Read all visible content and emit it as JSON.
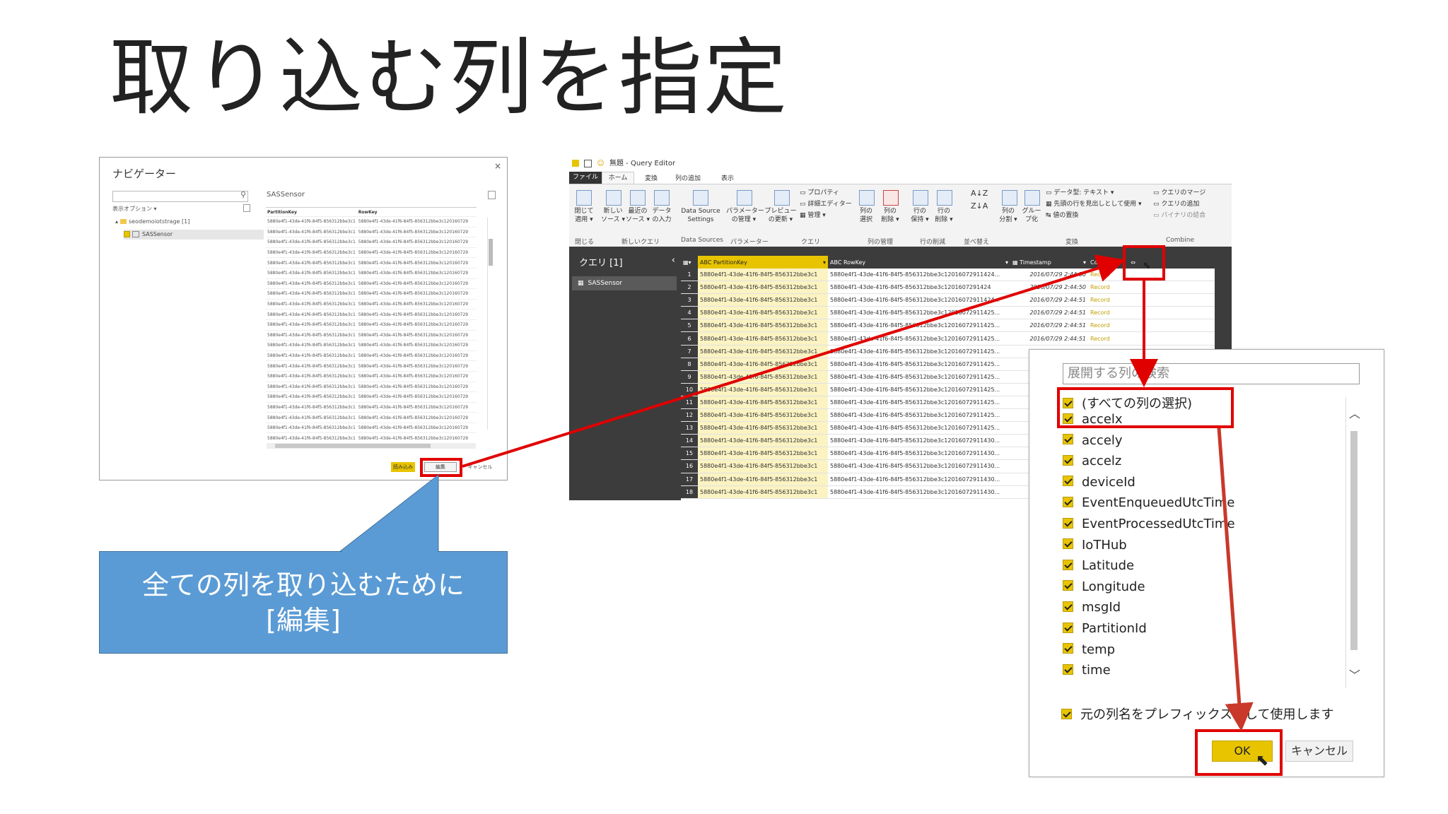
{
  "slide": {
    "title": "取り込む列を指定"
  },
  "navigator": {
    "title": "ナビゲーター",
    "close": "×",
    "options_label": "表示オプション ▾",
    "tree_storage": "seodemoiotstrage [1]",
    "tree_table": "SASSensor",
    "preview_title": "SASSensor",
    "columns": [
      "PartitionKey",
      "RowKey"
    ],
    "rows": [
      [
        "5880e4f1-43de-41f6-84f5-856312bbe3c1",
        "5880e4f1-43de-41f6-84f5-856312bbe3c120160729"
      ],
      [
        "5880e4f1-43de-41f6-84f5-856312bbe3c1",
        "5880e4f1-43de-41f6-84f5-856312bbe3c120160729"
      ],
      [
        "5880e4f1-43de-41f6-84f5-856312bbe3c1",
        "5880e4f1-43de-41f6-84f5-856312bbe3c120160729"
      ],
      [
        "5880e4f1-43de-41f6-84f5-856312bbe3c1",
        "5880e4f1-43de-41f6-84f5-856312bbe3c120160729"
      ],
      [
        "5880e4f1-43de-41f6-84f5-856312bbe3c1",
        "5880e4f1-43de-41f6-84f5-856312bbe3c120160729"
      ],
      [
        "5880e4f1-43de-41f6-84f5-856312bbe3c1",
        "5880e4f1-43de-41f6-84f5-856312bbe3c120160729"
      ],
      [
        "5880e4f1-43de-41f6-84f5-856312bbe3c1",
        "5880e4f1-43de-41f6-84f5-856312bbe3c120160729"
      ],
      [
        "5880e4f1-43de-41f6-84f5-856312bbe3c1",
        "5880e4f1-43de-41f6-84f5-856312bbe3c120160729"
      ],
      [
        "5880e4f1-43de-41f6-84f5-856312bbe3c1",
        "5880e4f1-43de-41f6-84f5-856312bbe3c120160729"
      ],
      [
        "5880e4f1-43de-41f6-84f5-856312bbe3c1",
        "5880e4f1-43de-41f6-84f5-856312bbe3c120160729"
      ],
      [
        "5880e4f1-43de-41f6-84f5-856312bbe3c1",
        "5880e4f1-43de-41f6-84f5-856312bbe3c120160729"
      ],
      [
        "5880e4f1-43de-41f6-84f5-856312bbe3c1",
        "5880e4f1-43de-41f6-84f5-856312bbe3c120160729"
      ],
      [
        "5880e4f1-43de-41f6-84f5-856312bbe3c1",
        "5880e4f1-43de-41f6-84f5-856312bbe3c120160729"
      ],
      [
        "5880e4f1-43de-41f6-84f5-856312bbe3c1",
        "5880e4f1-43de-41f6-84f5-856312bbe3c120160729"
      ],
      [
        "5880e4f1-43de-41f6-84f5-856312bbe3c1",
        "5880e4f1-43de-41f6-84f5-856312bbe3c120160729"
      ],
      [
        "5880e4f1-43de-41f6-84f5-856312bbe3c1",
        "5880e4f1-43de-41f6-84f5-856312bbe3c120160729"
      ],
      [
        "5880e4f1-43de-41f6-84f5-856312bbe3c1",
        "5880e4f1-43de-41f6-84f5-856312bbe3c120160729"
      ],
      [
        "5880e4f1-43de-41f6-84f5-856312bbe3c1",
        "5880e4f1-43de-41f6-84f5-856312bbe3c120160729"
      ],
      [
        "5880e4f1-43de-41f6-84f5-856312bbe3c1",
        "5880e4f1-43de-41f6-84f5-856312bbe3c120160729"
      ],
      [
        "5880e4f1-43de-41f6-84f5-856312bbe3c1",
        "5880e4f1-43de-41f6-84f5-856312bbe3c120160729"
      ],
      [
        "5880e4f1-43de-41f6-84f5-856312bbe3c1",
        "5880e4f1-43de-41f6-84f5-856312bbe3c120160729"
      ],
      [
        "5880e4f1-43de-41f6-84f5-856312bbe3c1",
        "5880e4f1-43de-41f6-84f5-856312bbe3c120160729"
      ],
      [
        "5880e4f1-43de-41f6-84f5-856312bbe3c1",
        "5880e4f1-43de-41f6-84f5-856312bbe3c120160729"
      ],
      [
        "5880e4f1-43de-41f6-84f5-856312bbe3c1",
        "5880e4f1-43de-41f6-84f5-856312bbe3c120160729"
      ]
    ],
    "buttons": {
      "load": "読み込み",
      "edit": "編集",
      "cancel": "キャンセル"
    }
  },
  "callout": {
    "line1": "全ての列を取り込むために",
    "line2": "[編集]"
  },
  "query_editor": {
    "title": "無題 - Query Editor",
    "tabs": [
      "ファイル",
      "ホーム",
      "変換",
      "列の追加",
      "表示"
    ],
    "ribbon": {
      "close_apply": [
        "閉じて",
        "適用 ▾"
      ],
      "new_source": [
        "新しい",
        "ソース ▾"
      ],
      "recent_source": [
        "最近の",
        "ソース ▾"
      ],
      "enter_data": [
        "データ",
        "の入力"
      ],
      "ds_settings": [
        "Data Source",
        "Settings"
      ],
      "params": [
        "パラメーター",
        "の管理 ▾"
      ],
      "preview": [
        "プレビュー",
        "の更新 ▾"
      ],
      "properties": "プロパティ",
      "adv_editor": "詳細エディター",
      "manage": "管理 ▾",
      "choose_cols": [
        "列の",
        "選択"
      ],
      "remove_cols": [
        "列の",
        "削除 ▾"
      ],
      "keep_rows": [
        "行の",
        "保持 ▾"
      ],
      "remove_rows": [
        "行の",
        "削除 ▾"
      ],
      "split_col": [
        "列の",
        "分割 ▾"
      ],
      "group_by": [
        "グルー",
        "プ化"
      ],
      "data_type": "データ型: テキスト ▾",
      "first_row_header": "先頭の行を見出しとして使用 ▾",
      "replace_values": "値の置換",
      "merge_queries": "クエリのマージ",
      "append_queries": "クエリの追加",
      "combine_binaries": "バイナリの結合",
      "groups": [
        "閉じる",
        "新しいクエリ",
        "Data Sources",
        "パラメーター",
        "クエリ",
        "列の管理",
        "行の削減",
        "並べ替え",
        "変換",
        "Combine"
      ]
    },
    "queries_header": "クエリ [1]",
    "query_item": "SASSensor",
    "columns": [
      "PartitionKey",
      "RowKey",
      "Timestamp",
      "Content"
    ],
    "rows": [
      {
        "n": "1",
        "pk": "5880e4f1-43de-41f6-84f5-856312bbe3c1",
        "rk": "5880e4f1-43de-41f6-84f5-856312bbe3c12016072911424...",
        "ts": "2016/07/29 2:44:50",
        "c": "Record"
      },
      {
        "n": "2",
        "pk": "5880e4f1-43de-41f6-84f5-856312bbe3c1",
        "rk": "5880e4f1-43de-41f6-84f5-856312bbe3c1201607291424",
        "ts": "2016/07/29 2:44:50",
        "c": "Record"
      },
      {
        "n": "3",
        "pk": "5880e4f1-43de-41f6-84f5-856312bbe3c1",
        "rk": "5880e4f1-43de-41f6-84f5-856312bbe3c12016072911424...",
        "ts": "2016/07/29 2:44:51",
        "c": "Record"
      },
      {
        "n": "4",
        "pk": "5880e4f1-43de-41f6-84f5-856312bbe3c1",
        "rk": "5880e4f1-43de-41f6-84f5-856312bbe3c12016072911425...",
        "ts": "2016/07/29 2:44:51",
        "c": "Record"
      },
      {
        "n": "5",
        "pk": "5880e4f1-43de-41f6-84f5-856312bbe3c1",
        "rk": "5880e4f1-43de-41f6-84f5-856312bbe3c12016072911425...",
        "ts": "2016/07/29 2:44:51",
        "c": "Record"
      },
      {
        "n": "6",
        "pk": "5880e4f1-43de-41f6-84f5-856312bbe3c1",
        "rk": "5880e4f1-43de-41f6-84f5-856312bbe3c12016072911425...",
        "ts": "2016/07/29 2:44:51",
        "c": "Record"
      },
      {
        "n": "7",
        "pk": "5880e4f1-43de-41f6-84f5-856312bbe3c1",
        "rk": "5880e4f1-43de-41f6-84f5-856312bbe3c12016072911425...",
        "ts": "2",
        "c": ""
      },
      {
        "n": "8",
        "pk": "5880e4f1-43de-41f6-84f5-856312bbe3c1",
        "rk": "5880e4f1-43de-41f6-84f5-856312bbe3c12016072911425...",
        "ts": "2",
        "c": ""
      },
      {
        "n": "9",
        "pk": "5880e4f1-43de-41f6-84f5-856312bbe3c1",
        "rk": "5880e4f1-43de-41f6-84f5-856312bbe3c12016072911425...",
        "ts": "2",
        "c": ""
      },
      {
        "n": "10",
        "pk": "5880e4f1-43de-41f6-84f5-856312bbe3c1",
        "rk": "5880e4f1-43de-41f6-84f5-856312bbe3c12016072911425...",
        "ts": "2",
        "c": ""
      },
      {
        "n": "11",
        "pk": "5880e4f1-43de-41f6-84f5-856312bbe3c1",
        "rk": "5880e4f1-43de-41f6-84f5-856312bbe3c12016072911425...",
        "ts": "2",
        "c": ""
      },
      {
        "n": "12",
        "pk": "5880e4f1-43de-41f6-84f5-856312bbe3c1",
        "rk": "5880e4f1-43de-41f6-84f5-856312bbe3c12016072911425...",
        "ts": "2",
        "c": ""
      },
      {
        "n": "13",
        "pk": "5880e4f1-43de-41f6-84f5-856312bbe3c1",
        "rk": "5880e4f1-43de-41f6-84f5-856312bbe3c12016072911425...",
        "ts": "2",
        "c": ""
      },
      {
        "n": "14",
        "pk": "5880e4f1-43de-41f6-84f5-856312bbe3c1",
        "rk": "5880e4f1-43de-41f6-84f5-856312bbe3c12016072911430...",
        "ts": "2",
        "c": ""
      },
      {
        "n": "15",
        "pk": "5880e4f1-43de-41f6-84f5-856312bbe3c1",
        "rk": "5880e4f1-43de-41f6-84f5-856312bbe3c12016072911430...",
        "ts": "2",
        "c": ""
      },
      {
        "n": "16",
        "pk": "5880e4f1-43de-41f6-84f5-856312bbe3c1",
        "rk": "5880e4f1-43de-41f6-84f5-856312bbe3c12016072911430...",
        "ts": "2",
        "c": ""
      },
      {
        "n": "17",
        "pk": "5880e4f1-43de-41f6-84f5-856312bbe3c1",
        "rk": "5880e4f1-43de-41f6-84f5-856312bbe3c12016072911430...",
        "ts": "2",
        "c": ""
      },
      {
        "n": "18",
        "pk": "5880e4f1-43de-41f6-84f5-856312bbe3c1",
        "rk": "5880e4f1-43de-41f6-84f5-856312bbe3c12016072911430...",
        "ts": "2",
        "c": ""
      }
    ]
  },
  "expand_popup": {
    "search_placeholder": "展開する列の検索",
    "select_all": "(すべての列の選択)",
    "items": [
      "accelx",
      "accely",
      "accelz",
      "deviceId",
      "EventEnqueuedUtcTime",
      "EventProcessedUtcTime",
      "IoTHub",
      "Latitude",
      "Longitude",
      "msgId",
      "PartitionId",
      "temp",
      "time"
    ],
    "prefix_label": "元の列名をプレフィックスとして使用します",
    "ok": "OK",
    "cancel": "キャンセル"
  },
  "colors": {
    "accent_yellow": "#e8c400",
    "annotation_red": "#e00000",
    "callout_blue": "#5b9bd5",
    "editor_dark": "#3c3c3c"
  }
}
